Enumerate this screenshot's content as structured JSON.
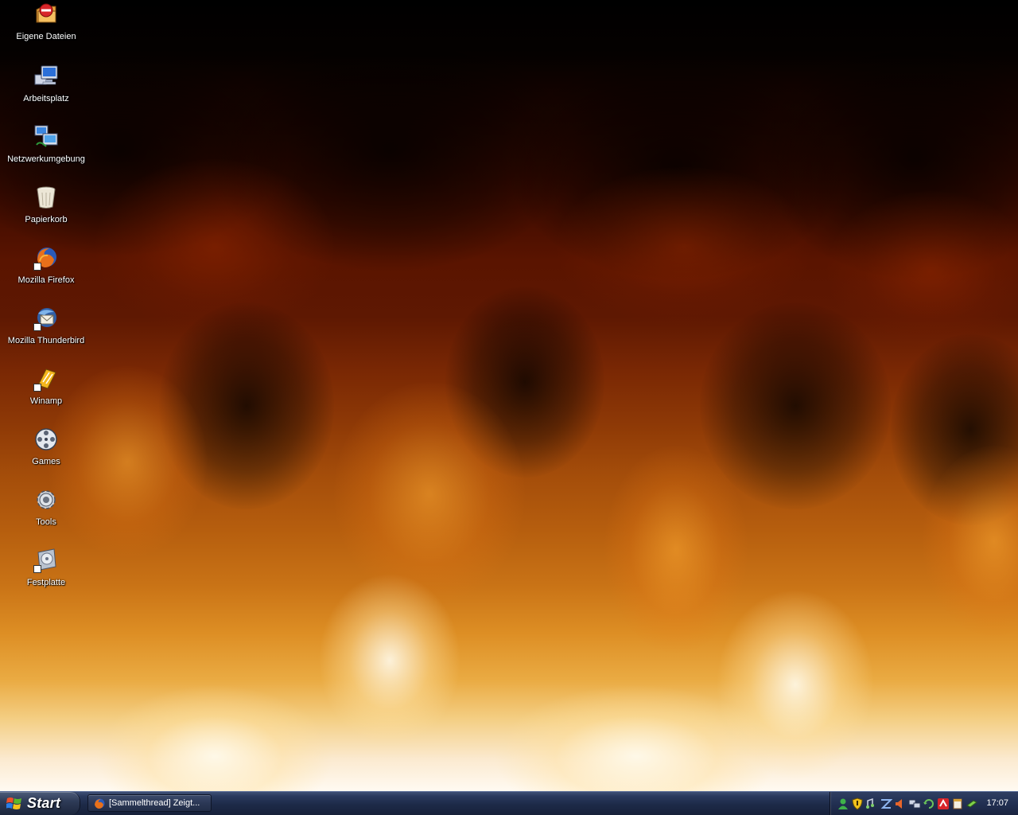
{
  "desktop": {
    "icons": [
      {
        "label": "Eigene Dateien",
        "icon": "my-documents-icon"
      },
      {
        "label": "Arbeitsplatz",
        "icon": "my-computer-icon"
      },
      {
        "label": "Netzwerkumgebung",
        "icon": "network-places-icon"
      },
      {
        "label": "Papierkorb",
        "icon": "recycle-bin-icon"
      },
      {
        "label": "Mozilla Firefox",
        "icon": "firefox-icon"
      },
      {
        "label": "Mozilla Thunderbird",
        "icon": "thunderbird-icon"
      },
      {
        "label": "Winamp",
        "icon": "winamp-icon"
      },
      {
        "label": "Games",
        "icon": "games-film-reel-icon"
      },
      {
        "label": "Tools",
        "icon": "tools-gear-icon"
      },
      {
        "label": "Festplatte",
        "icon": "hard-drive-icon"
      }
    ],
    "wallpaper": "fire-flames-wallpaper"
  },
  "taskbar": {
    "start_label": "Start",
    "tasks": [
      {
        "label": "[Sammelthread] Zeigt...",
        "icon": "firefox-icon"
      }
    ],
    "tray": {
      "icons": [
        "user-status-icon",
        "security-shield-icon",
        "audio-icon",
        "app-z-icon",
        "speaker-icon",
        "network-icon",
        "update-icon",
        "antivirus-umbrella-icon",
        "notepad-icon",
        "battery-icon"
      ],
      "clock": "17:07"
    }
  },
  "colors": {
    "taskbar": "#1d2a48",
    "wallpaper_top": "#000000",
    "wallpaper_bottom": "#fffaf2"
  }
}
